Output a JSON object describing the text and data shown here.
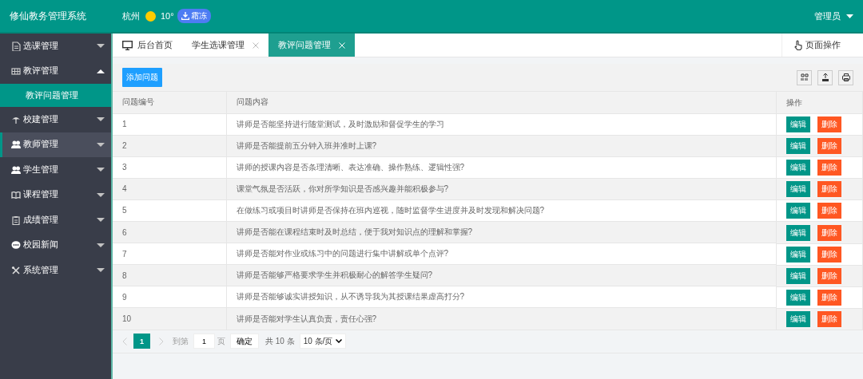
{
  "header": {
    "title": "修仙教务管理系统",
    "city": "杭州",
    "temperature": "10°",
    "weather_badge": "霜冻",
    "user": "管理员"
  },
  "sidebar": {
    "items": [
      {
        "label": "选课管理",
        "expanded": false,
        "selected": false
      },
      {
        "label": "教评管理",
        "expanded": true,
        "selected": false,
        "children": [
          {
            "label": "教评问题管理",
            "selected": true
          }
        ]
      },
      {
        "label": "校建管理",
        "expanded": false,
        "selected": false
      },
      {
        "label": "教师管理",
        "expanded": false,
        "selected": true
      },
      {
        "label": "学生管理",
        "expanded": false,
        "selected": false
      },
      {
        "label": "课程管理",
        "expanded": false,
        "selected": false
      },
      {
        "label": "成绩管理",
        "expanded": false,
        "selected": false
      },
      {
        "label": "校园新闻",
        "expanded": false,
        "selected": false
      },
      {
        "label": "系统管理",
        "expanded": false,
        "selected": false
      }
    ]
  },
  "tabs": [
    {
      "label": "后台首页",
      "kind": "home",
      "selected": false
    },
    {
      "label": "学生选课管理",
      "kind": "closable",
      "selected": false
    },
    {
      "label": "教评问题管理",
      "kind": "closable",
      "selected": true
    }
  ],
  "page_actions": "页面操作",
  "toolbar": {
    "add_button": "添加问题"
  },
  "table": {
    "columns": [
      "问题编号",
      "问题内容",
      "操作"
    ],
    "rows": [
      {
        "id": "1",
        "content": "讲师是否能坚持进行随堂测试，及时激励和督促学生的学习",
        "edit": "编辑",
        "delete": "删除"
      },
      {
        "id": "2",
        "content": "讲师是否能提前五分钟入班并准时上课?",
        "edit": "编辑",
        "delete": "删除"
      },
      {
        "id": "3",
        "content": "讲师的授课内容是否条理清晰、表达准确、操作熟练、逻辑性强?",
        "edit": "编辑",
        "delete": "删除"
      },
      {
        "id": "4",
        "content": "课堂气氛是否活跃，你对所学知识是否感兴趣并能积极参与?",
        "edit": "编辑",
        "delete": "删除"
      },
      {
        "id": "5",
        "content": "在做练习或项目时讲师是否保持在班内巡视，随时监督学生进度并及时发现和解决问题?",
        "edit": "编辑",
        "delete": "删除"
      },
      {
        "id": "6",
        "content": "讲师是否能在课程结束时及时总结，便于我对知识点的理解和掌握?",
        "edit": "编辑",
        "delete": "删除"
      },
      {
        "id": "7",
        "content": "讲师是否能对作业或练习中的问题进行集中讲解或单个点评?",
        "edit": "编辑",
        "delete": "删除"
      },
      {
        "id": "8",
        "content": "讲师是否能够严格要求学生并积极耐心的解答学生疑问?",
        "edit": "编辑",
        "delete": "删除"
      },
      {
        "id": "9",
        "content": "讲师是否能够诚实讲授知识，从不诱导我为其授课结果虚高打分?",
        "edit": "编辑",
        "delete": "删除"
      },
      {
        "id": "10",
        "content": "讲师是否能对学生认真负责，责任心强?",
        "edit": "编辑",
        "delete": "删除"
      }
    ]
  },
  "pagination": {
    "pages": [
      {
        "label": "1",
        "selected": true
      }
    ],
    "goto_label": "到第",
    "goto_value": "1",
    "page_unit": "页",
    "confirm": "确定",
    "total": "共 10 条",
    "page_size": "10 条/页"
  }
}
